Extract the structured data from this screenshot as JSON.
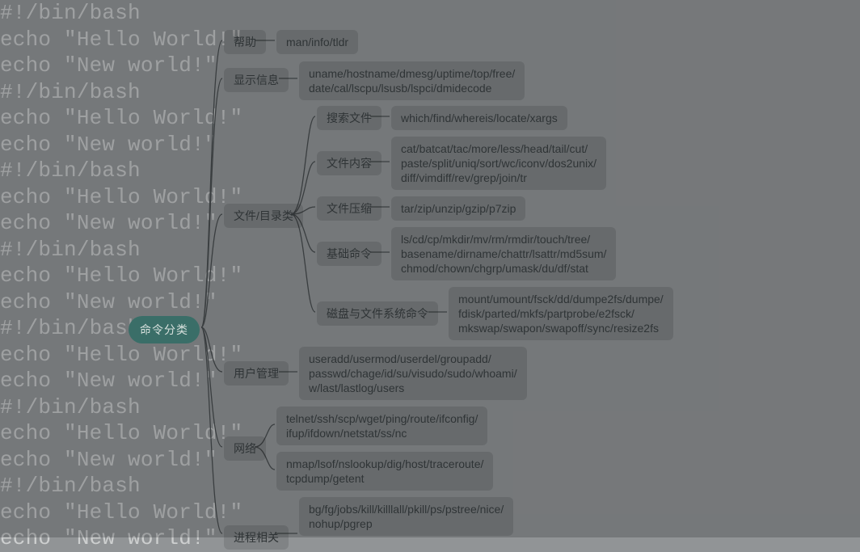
{
  "background_script_lines": [
    "#!/bin/bash",
    "echo \"Hello World!\"",
    "echo \"New world!\"",
    "#!/bin/bash",
    "echo \"Hello World!\"",
    "echo \"New world!\"",
    "#!/bin/bash",
    "echo \"Hello World!\"",
    "echo \"New world!\"",
    "#!/bin/bash",
    "echo \"Hello World!\"",
    "echo \"New world!\"",
    "#!/bin/bash",
    "echo \"Hello World!\"",
    "echo \"New world!\"",
    "#!/bin/bash",
    "echo \"Hello World!\"",
    "echo \"New world!\"",
    "#!/bin/bash",
    "echo \"Hello World!\"",
    "echo \"New world!\""
  ],
  "root": {
    "label": "命令分类"
  },
  "branches": {
    "help": {
      "label": "帮助",
      "leaf": "man/info/tldr"
    },
    "sysinfo": {
      "label": "显示信息",
      "leaf": "uname/hostname/dmesg/uptime/top/free/\ndate/cal/lscpu/lsusb/lspci/dmidecode"
    },
    "file": {
      "label": "文件/目录类",
      "children": {
        "search": {
          "label": "搜索文件",
          "leaf": "which/find/whereis/locate/xargs"
        },
        "content": {
          "label": "文件内容",
          "leaf": "cat/batcat/tac/more/less/head/tail/cut/\npaste/split/uniq/sort/wc/iconv/dos2unix/\ndiff/vimdiff/rev/grep/join/tr"
        },
        "compress": {
          "label": "文件压缩",
          "leaf": "tar/zip/unzip/gzip/p7zip"
        },
        "basic": {
          "label": "基础命令",
          "leaf": "ls/cd/cp/mkdir/mv/rm/rmdir/touch/tree/\nbasename/dirname/chattr/lsattr/md5sum/\nchmod/chown/chgrp/umask/du/df/stat"
        },
        "disk": {
          "label": "磁盘与文件系统命令",
          "leaf": "mount/umount/fsck/dd/dumpe2fs/dumpe/\nfdisk/parted/mkfs/partprobe/e2fsck/\nmkswap/swapon/swapoff/sync/resize2fs"
        }
      }
    },
    "user": {
      "label": "用户管理",
      "leaf": "useradd/usermod/userdel/groupadd/\npasswd/chage/id/su/visudo/sudo/whoami/\nw/last/lastlog/users"
    },
    "net": {
      "label": "网络",
      "leaves": [
        "telnet/ssh/scp/wget/ping/route/ifconfig/\nifup/ifdown/netstat/ss/nc",
        "nmap/lsof/nslookup/dig/host/traceroute/\ntcpdump/getent"
      ]
    },
    "proc": {
      "label": "进程相关",
      "leaf": "bg/fg/jobs/kill/killlall/pkill/ps/pstree/nice/\nnohup/pgrep"
    }
  }
}
